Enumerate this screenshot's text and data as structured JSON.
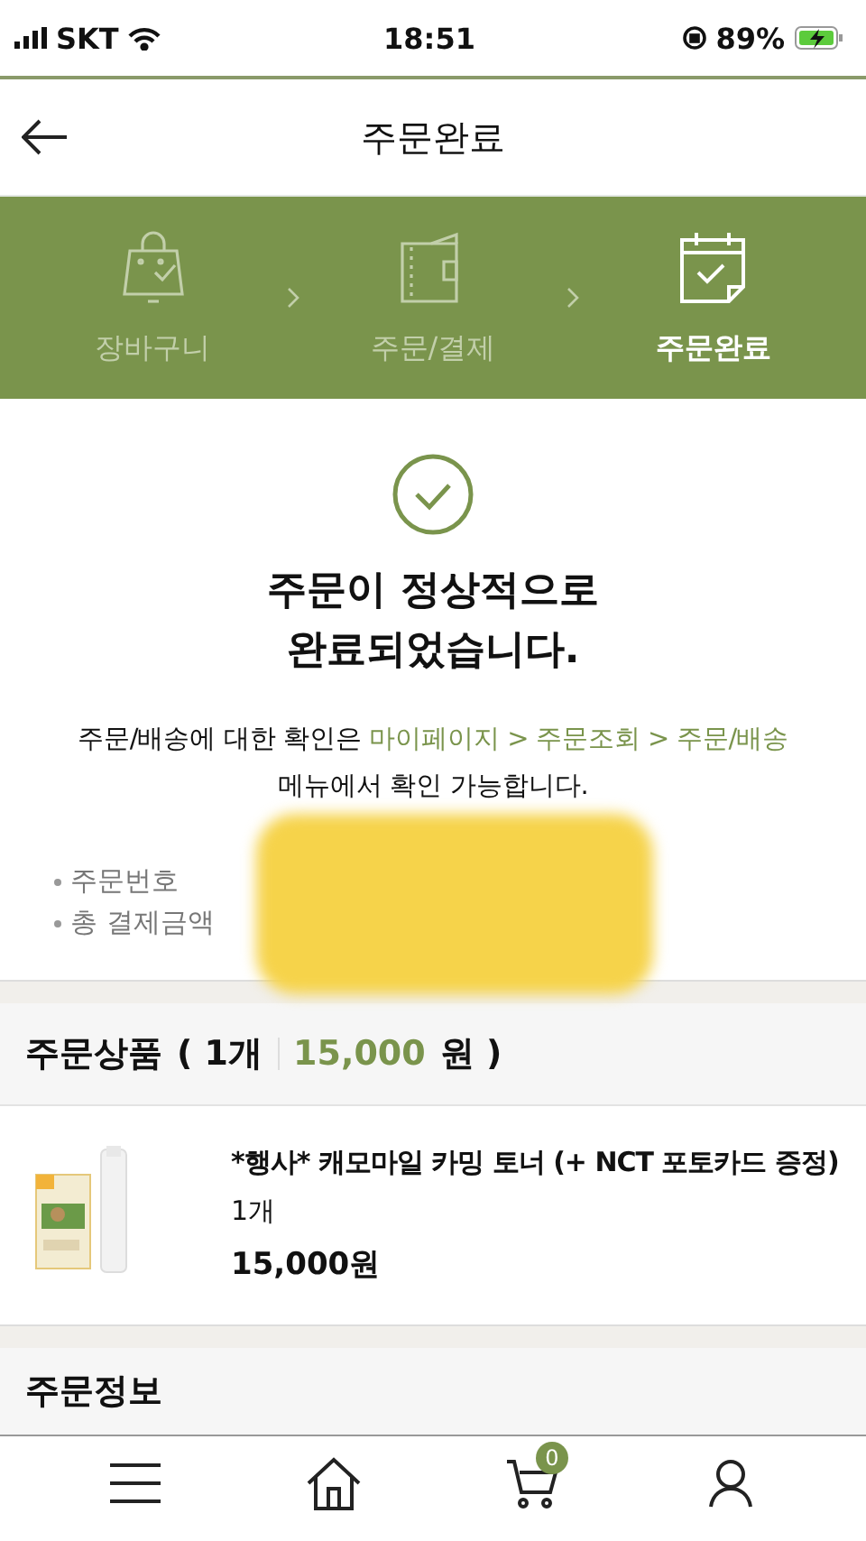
{
  "status_bar": {
    "carrier": "SKT",
    "time": "18:51",
    "battery": "89%"
  },
  "header": {
    "title": "주문완료"
  },
  "steps": [
    {
      "label": "장바구니",
      "kind": "bag",
      "selected": false
    },
    {
      "label": "주문/결제",
      "kind": "wallet",
      "selected": false
    },
    {
      "label": "주문완료",
      "kind": "calendar",
      "selected": true
    }
  ],
  "confirmation": {
    "title_lines": [
      "주문이 정상적으로",
      "완료되었습니다."
    ],
    "notice_before": "주문/배송에 대한 확인은",
    "notice_link": "마이페이지 > 주문조회 > 주문/배송",
    "notice_after": "메뉴에서 확인 가능합니다.",
    "fields": [
      "주문번호",
      "총 결제금액"
    ]
  },
  "order_items": {
    "title": "주문상품",
    "count": "( 1개",
    "total": "15,000",
    "unit": "원 )",
    "items": [
      {
        "name": "*행사* 캐모마일 카밍 토너 (+ NCT 포토카드 증정)",
        "quantity": "1개",
        "price": "15,000원"
      }
    ]
  },
  "order_info": {
    "title": "주문정보"
  },
  "bottom_nav": [
    {
      "kind": "menu"
    },
    {
      "kind": "home"
    },
    {
      "kind": "cart",
      "badge": "0"
    },
    {
      "kind": "user"
    }
  ]
}
